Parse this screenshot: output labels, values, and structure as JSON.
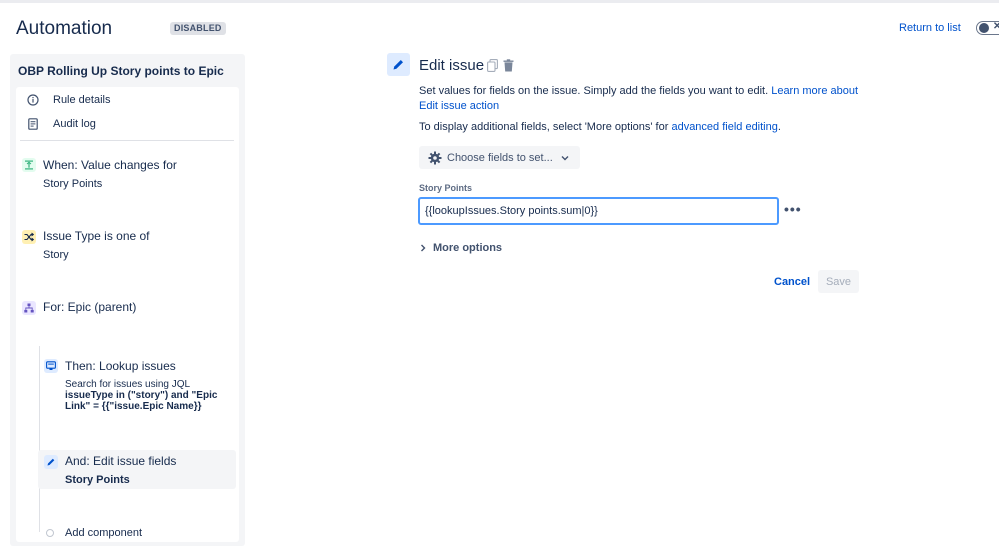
{
  "header": {
    "title": "Automation",
    "status_badge": "DISABLED",
    "return_link": "Return to list"
  },
  "sidebar": {
    "rule_name": "OBP Rolling Up Story points to Epic",
    "links": [
      {
        "label": "Rule details",
        "icon": "info-icon"
      },
      {
        "label": "Audit log",
        "icon": "document-icon"
      }
    ],
    "components": [
      {
        "title": "When: Value changes for",
        "subtitle": "Story Points",
        "icon": "trigger-icon",
        "color": "#36b37e"
      },
      {
        "title": "Issue Type is one of",
        "subtitle": "Story",
        "icon": "shuffle-icon",
        "color": "#ffab00"
      },
      {
        "title": "For: Epic (parent)",
        "subtitle": "",
        "icon": "hierarchy-icon",
        "color": "#6554c0"
      },
      {
        "title": "Then: Lookup issues",
        "desc_prefix": "Search for issues using JQL",
        "desc_bold": "issueType in (\"story\") and \"Epic Link\" = {{\"issue.Epic Name}}",
        "icon": "lookup-icon",
        "color": "#0052cc"
      },
      {
        "title": "And: Edit issue fields",
        "subtitle": "Story Points",
        "icon": "pencil-icon",
        "color": "#0052cc"
      }
    ],
    "add_component": "Add component"
  },
  "editor": {
    "title": "Edit issue",
    "description": "Set values for fields on the issue. Simply add the fields you want to edit.",
    "learn_more_link": "Learn more about Edit issue action",
    "display_text": "To display additional fields, select 'More options' for",
    "advanced_link": "advanced field editing",
    "period": ".",
    "choose_fields_label": "Choose fields to set...",
    "field_label": "Story Points",
    "field_value": "{{lookupIssues.Story points.sum|0}}",
    "more_options_label": "More options",
    "cancel_label": "Cancel",
    "save_label": "Save"
  },
  "colors": {
    "accent": "#0052cc",
    "focus": "#4c9aff"
  }
}
